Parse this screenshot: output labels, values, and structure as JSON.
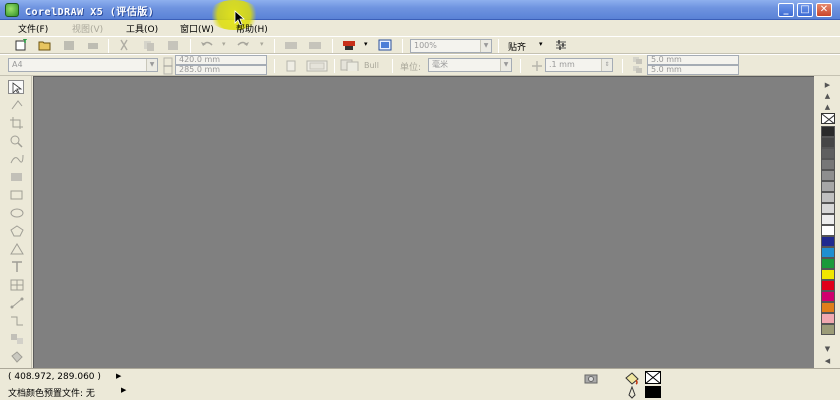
{
  "window": {
    "title": "CorelDRAW X5 (评估版)",
    "minimize": "_",
    "maximize": "□",
    "close": "✕"
  },
  "menu": {
    "items": [
      {
        "label": "文件(F)",
        "enabled": true
      },
      {
        "label": "视图(V)",
        "enabled": false
      },
      {
        "label": "工具(O)",
        "enabled": true
      },
      {
        "label": "窗口(W)",
        "enabled": true
      },
      {
        "label": "帮助(H)",
        "enabled": true
      }
    ]
  },
  "standard_toolbar": {
    "zoom_value": "100%",
    "snap_label": "贴齐"
  },
  "property_bar": {
    "paper_size": "A4",
    "page_width": "420.0 mm",
    "page_height": "285.0 mm",
    "bullet_label": "Bull",
    "units_label": "单位:",
    "units_value": "毫米",
    "nudge_value": ".1 mm",
    "dup_x": "5.0 mm",
    "dup_y": "5.0 mm"
  },
  "palette": {
    "scroll_up": "▲",
    "scroll_down": "▼",
    "expand": "▶",
    "collapse": "◀",
    "colors": [
      "#2a2a2a",
      "#464646",
      "#5f5f5f",
      "#777777",
      "#8e8e8e",
      "#a6a6a6",
      "#bfbfbf",
      "#d7d7d7",
      "#ededed",
      "#ffffff",
      "#1f2a8f",
      "#1f8fd0",
      "#1a9a3a",
      "#f0e600",
      "#e0001a",
      "#d0006e",
      "#e07e1a",
      "#f0a8b0",
      "#9c9c78"
    ]
  },
  "status": {
    "coordinates": "( 408.972, 289.060 )",
    "color_profile": "文档颜色预置文件: 无",
    "arrow": "▶"
  },
  "icons": {
    "app": "coreldraw-icon",
    "fill": "fill-icon",
    "outline": "outline-icon"
  }
}
